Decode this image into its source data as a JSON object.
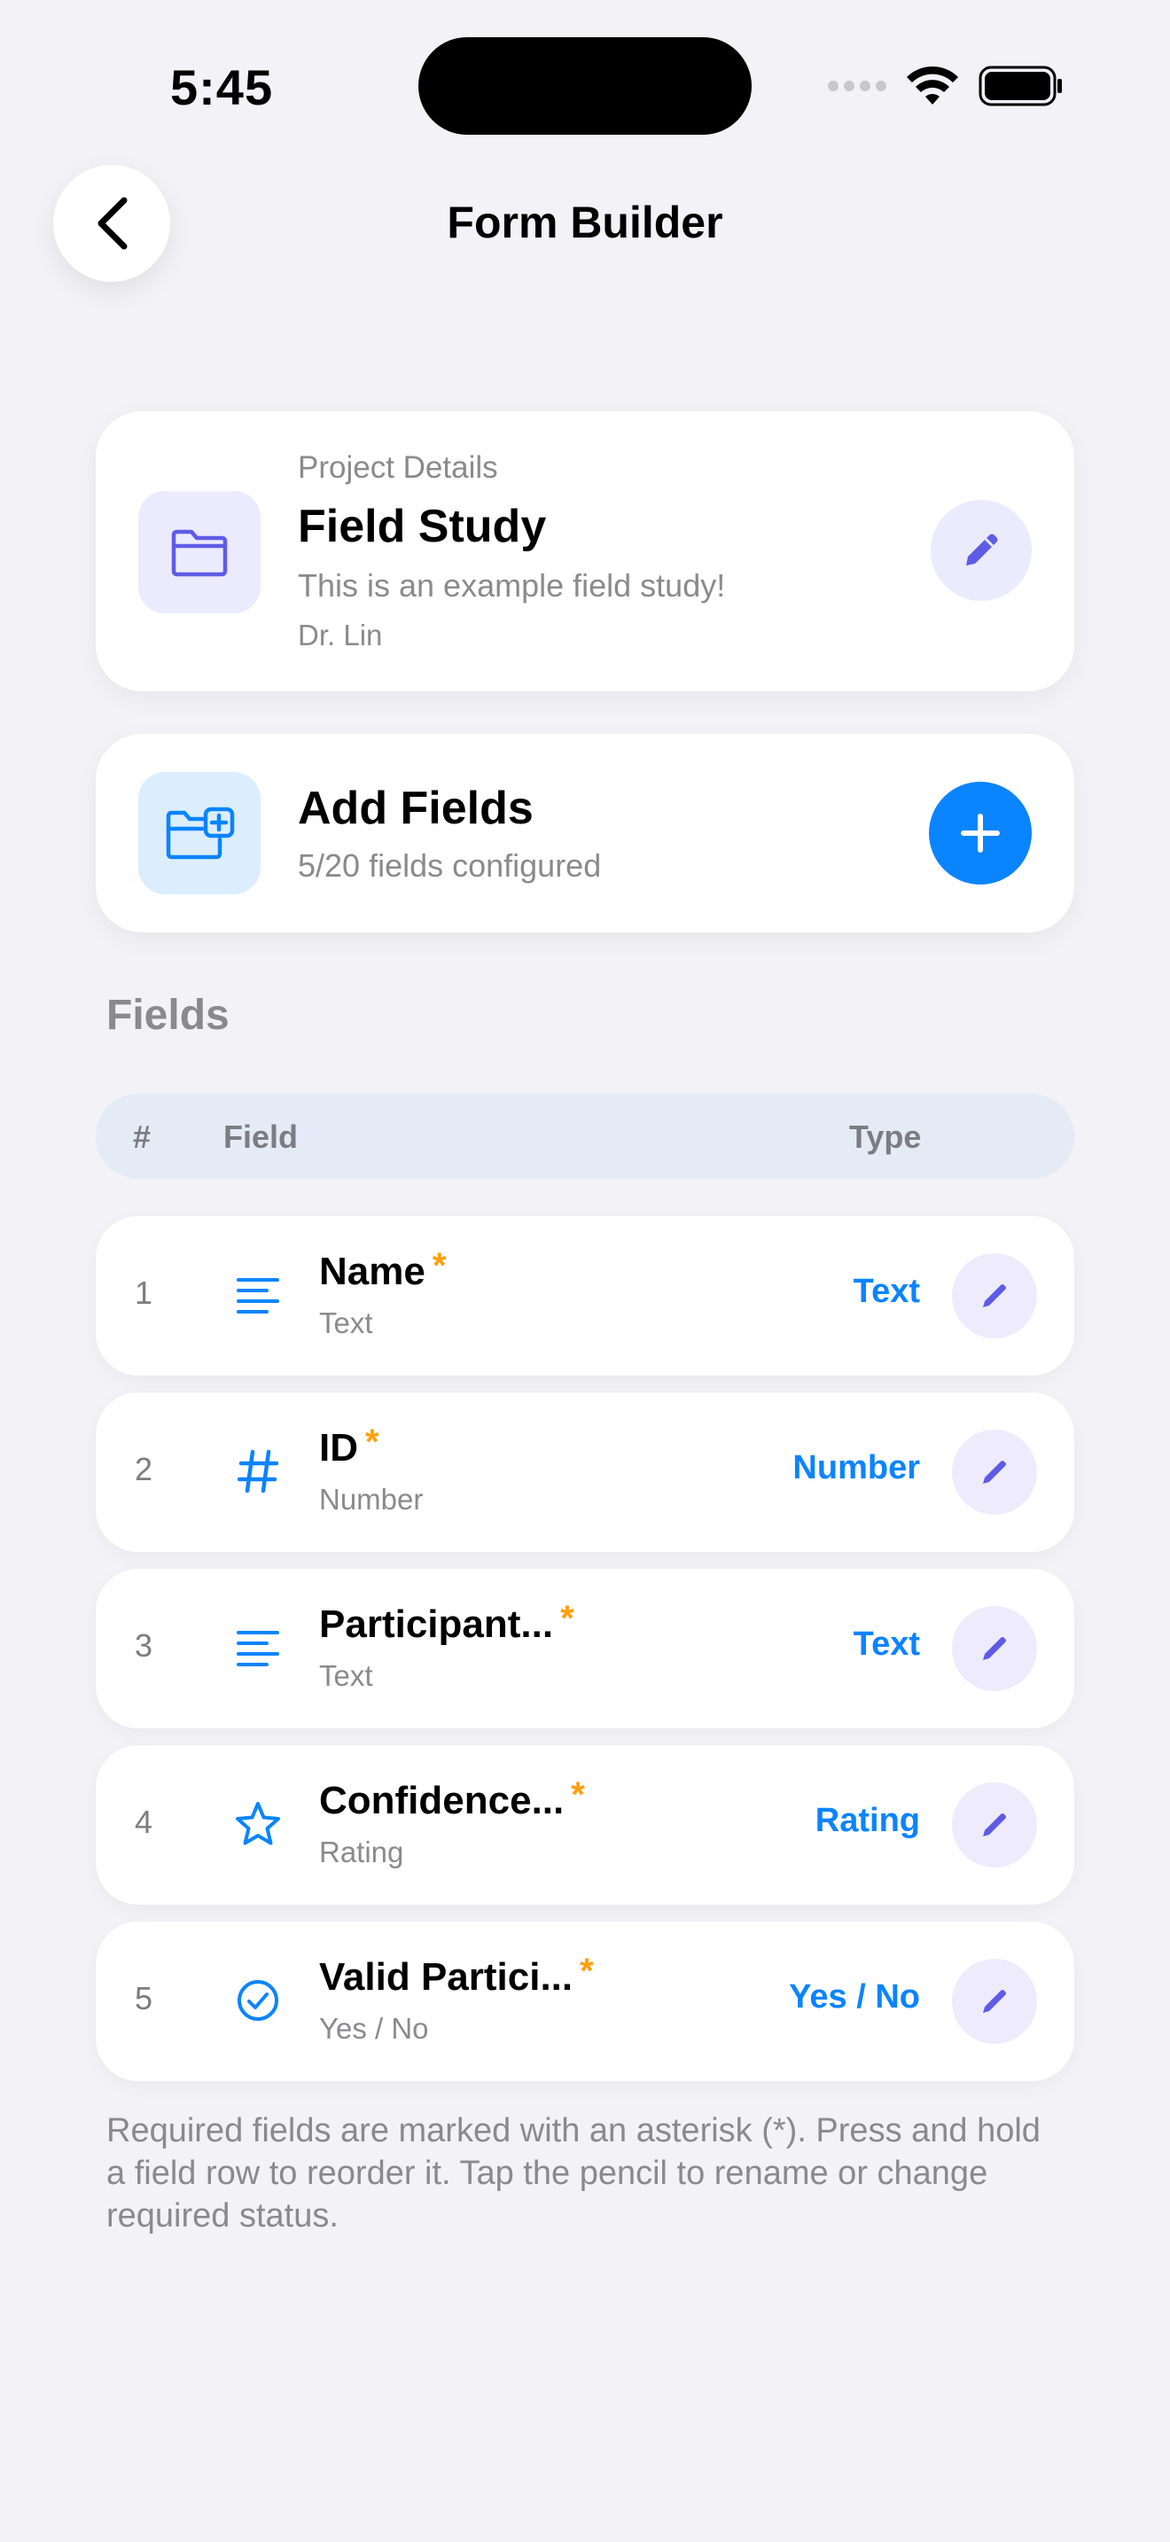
{
  "status_bar": {
    "time": "5:45"
  },
  "nav": {
    "title": "Form Builder"
  },
  "project": {
    "label": "Project Details",
    "title": "Field Study",
    "description": "This is an example field study!",
    "author": "Dr. Lin"
  },
  "add_fields": {
    "title": "Add Fields",
    "subtitle": "5/20 fields configured"
  },
  "fields_section": {
    "title": "Fields",
    "columns": {
      "num": "#",
      "field": "Field",
      "type": "Type"
    },
    "rows": [
      {
        "num": "1",
        "icon": "text-lines-icon",
        "name": "Name",
        "required": "*",
        "subtype": "Text",
        "type": "Text"
      },
      {
        "num": "2",
        "icon": "hash-icon",
        "name": "ID",
        "required": "*",
        "subtype": "Number",
        "type": "Number"
      },
      {
        "num": "3",
        "icon": "text-lines-icon",
        "name": "Participant...",
        "required": "*",
        "subtype": "Text",
        "type": "Text"
      },
      {
        "num": "4",
        "icon": "star-icon",
        "name": "Confidence...",
        "required": "*",
        "subtype": "Rating",
        "type": "Rating"
      },
      {
        "num": "5",
        "icon": "check-circle-icon",
        "name": "Valid Partici...",
        "required": "*",
        "subtype": "Yes / No",
        "type": "Yes / No"
      }
    ]
  },
  "footer": {
    "note": "Required fields are marked with an asterisk (*). Press and hold a field row to reorder it. Tap the pencil to rename or change required status."
  },
  "colors": {
    "accent_blue": "#0A84FF",
    "accent_purple": "#5E5CE6",
    "required_orange": "#FF9F0A",
    "background": "#F2F2F7"
  }
}
